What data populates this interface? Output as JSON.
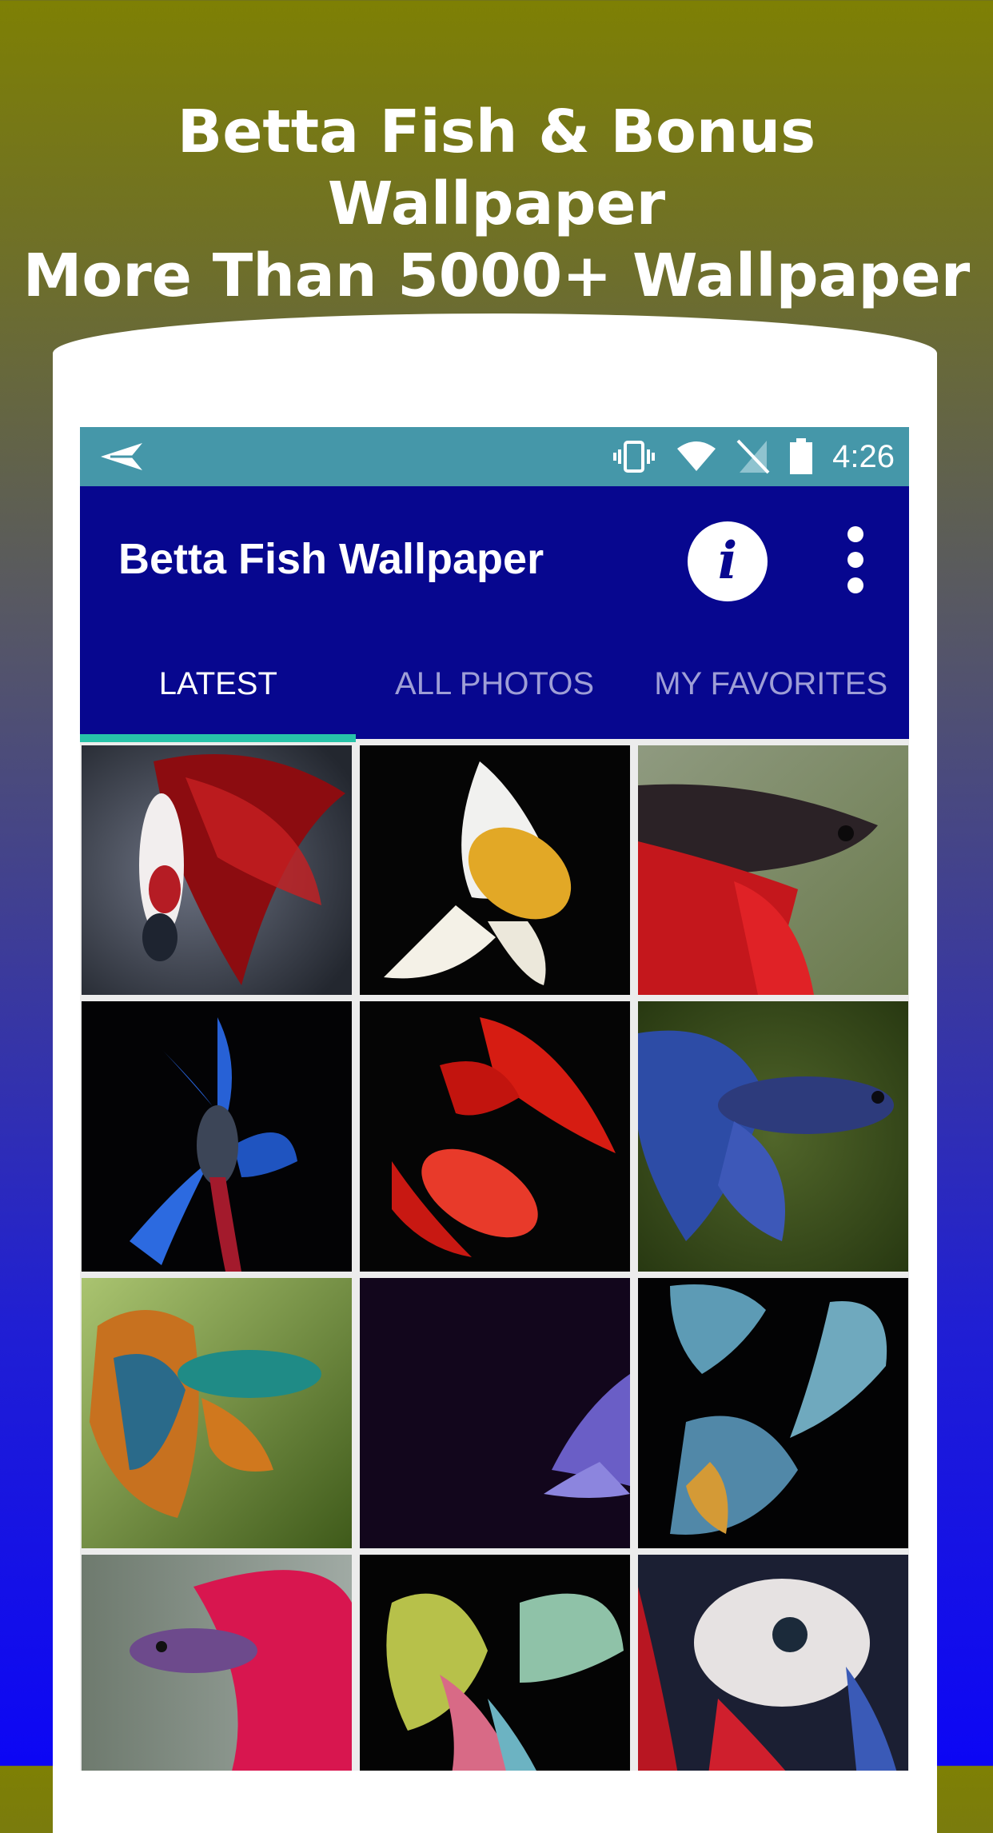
{
  "promo": {
    "line1": "Betta Fish & Bonus Wallpaper",
    "line2": "More Than 5000+ Wallpaper"
  },
  "status_bar": {
    "time": "4:26",
    "icons": [
      "send-icon",
      "vibrate-icon",
      "wifi-icon",
      "no-sim-icon",
      "battery-icon"
    ]
  },
  "app_bar": {
    "title": "Betta Fish Wallpaper",
    "info_label": "i",
    "icons": [
      "info-icon",
      "more-vert-icon"
    ]
  },
  "tabs": [
    {
      "label": "LATEST",
      "active": true
    },
    {
      "label": "ALL PHOTOS",
      "active": false
    },
    {
      "label": "MY FAVORITES",
      "active": false
    }
  ],
  "colors": {
    "status_bar": "#4597a9",
    "app_bar": "#07078f",
    "tab_indicator": "#27c3a9"
  },
  "wallpapers": [
    {
      "subject": "red and white betta on grey"
    },
    {
      "subject": "yellow and white betta on black"
    },
    {
      "subject": "black and red betta on green"
    },
    {
      "subject": "blue crowntail betta on black"
    },
    {
      "subject": "red betta on black"
    },
    {
      "subject": "blue halfmoon betta on green"
    },
    {
      "subject": "teal and orange betta on green"
    },
    {
      "subject": "purple fins on dark purple"
    },
    {
      "subject": "group of pastel bettas on black"
    },
    {
      "subject": "pink and blue betta"
    },
    {
      "subject": "multicolor betta fins on black"
    },
    {
      "subject": "white and red koi betta"
    }
  ]
}
